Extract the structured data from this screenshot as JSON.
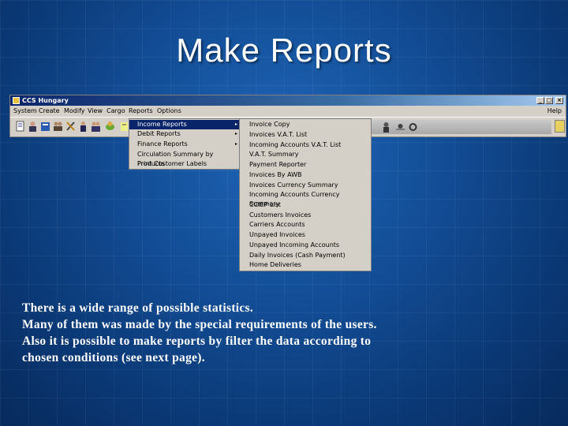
{
  "slide": {
    "title": "Make Reports",
    "body_lines": [
      "There is a wide range of possible statistics.",
      "Many of them was made by the special requirements of the users.",
      "Also it is possible to make reports by filter the data according to",
      "chosen conditions (see next page)."
    ]
  },
  "window": {
    "title": "CCS Hungary",
    "menubar": [
      "System",
      "Create",
      "Modify",
      "View",
      "Cargo",
      "Reports",
      "Options"
    ],
    "help": "Help",
    "controls": [
      "_",
      "□",
      "×"
    ]
  },
  "reports_menu": {
    "items": [
      {
        "label": "Income Reports"
      },
      {
        "label": "Debit Reports"
      },
      {
        "label": "Finance Reports"
      },
      {
        "label": "Circulation Summary by Products"
      },
      {
        "label": "Print Customer Labels"
      }
    ],
    "submenu_arrow": "▸"
  },
  "income_submenu": {
    "items": [
      "Invoice Copy",
      "Invoices V.A.T. List",
      "Incoming Accounts V.A.T. List",
      "V.A.T. Summary",
      "Payment Reporter",
      "Invoices By AWB",
      "Invoices Currency Summary",
      "Incoming Accounts Currency Summary",
      "CCIEP List",
      "Customers Invoices",
      "Carriers Accounts",
      "Unpayed Invoices",
      "Unpayed Incoming Accounts",
      "Daily Invoices (Cash Payment)",
      "Home Deliveries"
    ]
  },
  "colors": {
    "background": "#14509a",
    "menu_selection": "#0a246a",
    "window_face": "#d4d0c8"
  },
  "toolbar": {
    "icons": [
      "document-icon",
      "user-icon",
      "stack-icon",
      "people-icon",
      "tools-icon",
      "person-icon",
      "group-icon",
      "car-icon",
      "report-icon",
      "stamp-icon",
      "person-icon",
      "bug-icon",
      "help-icon"
    ]
  }
}
